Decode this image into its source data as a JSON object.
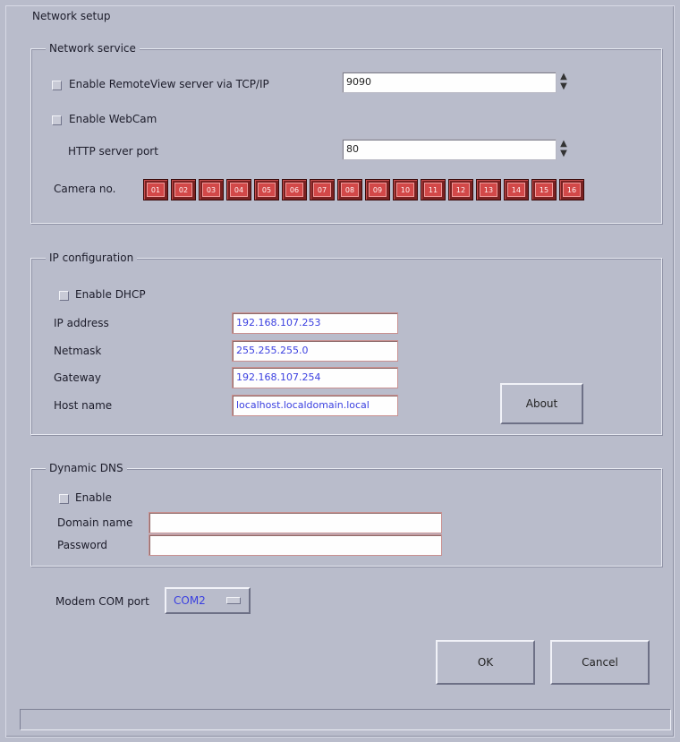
{
  "window": {
    "title": "Network setup"
  },
  "network_service": {
    "legend": "Network service",
    "remoteview_label": "Enable RemoteView server via TCP/IP",
    "remoteview_port": "9090",
    "webcam_label": "Enable WebCam",
    "http_port_label": "HTTP server port",
    "http_port": "80",
    "camera_label": "Camera no.",
    "cameras": [
      "01",
      "02",
      "03",
      "04",
      "05",
      "06",
      "07",
      "08",
      "09",
      "10",
      "11",
      "12",
      "13",
      "14",
      "15",
      "16"
    ]
  },
  "ip_config": {
    "legend": "IP configuration",
    "dhcp_label": "Enable DHCP",
    "ip_label": "IP address",
    "ip_value": "192.168.107.253",
    "netmask_label": "Netmask",
    "netmask_value": "255.255.255.0",
    "gateway_label": "Gateway",
    "gateway_value": "192.168.107.254",
    "hostname_label": "Host name",
    "hostname_value": "localhost.localdomain.local",
    "about_label": "About"
  },
  "dyn_dns": {
    "legend": "Dynamic DNS",
    "enable_label": "Enable",
    "domain_label": "Domain name",
    "domain_value": "",
    "password_label": "Password",
    "password_value": ""
  },
  "modem": {
    "label": "Modem COM port",
    "value": "COM2"
  },
  "buttons": {
    "ok": "OK",
    "cancel": "Cancel"
  },
  "icons": {
    "spin": "spin-arrows-icon",
    "check": "checkbox-icon",
    "combo": "dropdown-indicator-icon"
  }
}
